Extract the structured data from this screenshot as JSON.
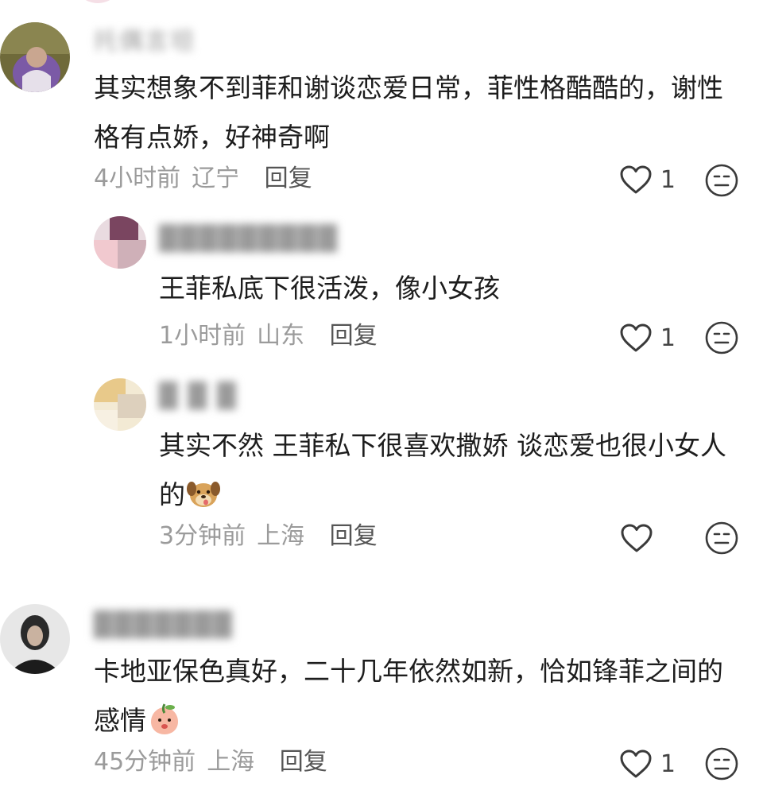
{
  "comments": [
    {
      "username": "托偶言坦",
      "text": "其实想象不到菲和谢谈恋爱日常，菲性格酷酷的，谢性格有点娇，好神奇啊",
      "time": "4小时前",
      "location": "辽宁",
      "reply_label": "回复",
      "likes": "1",
      "replies": [
        {
          "username": "█████████",
          "text": "王菲私底下很活泼，像小女孩",
          "time": "1小时前",
          "location": "山东",
          "reply_label": "回复",
          "likes": "1"
        },
        {
          "username": "█ █ █",
          "text": "其实不然 王菲私下很喜欢撒娇 谈恋爱也很小女人的",
          "emoji": "puppy-face-emoji",
          "time": "3分钟前",
          "location": "上海",
          "reply_label": "回复",
          "likes": ""
        }
      ]
    },
    {
      "username": "███████",
      "text": "卡地亚保色真好，二十几年依然如新，恰如锋菲之间的感情",
      "emoji": "peach-face-emoji",
      "time": "45分钟前",
      "location": "上海",
      "reply_label": "回复",
      "likes": "1"
    }
  ],
  "icons": {
    "like": "heart-outline-icon",
    "dislike": "neutral-face-icon"
  },
  "colors": {
    "meta_text": "#9b9b9b",
    "body_text": "#1d1d1d",
    "icon_stroke": "#3a3a3a"
  }
}
